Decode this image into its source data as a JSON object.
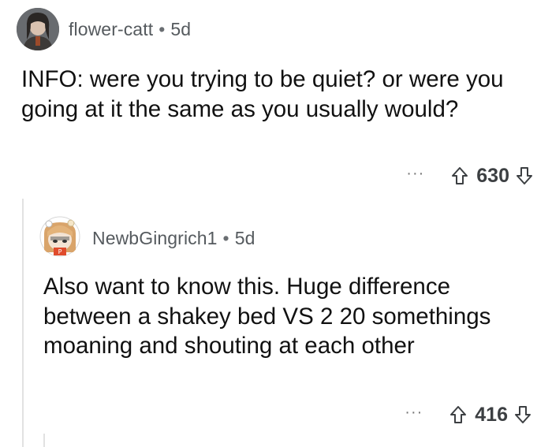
{
  "comments": [
    {
      "username": "flower-catt",
      "separator": "•",
      "age": "5d",
      "text": "INFO: were you trying to be quiet? or were you going at it the same as you usually would?",
      "more": "···",
      "score": "630",
      "avatar_icon": "user-avatar-photo"
    },
    {
      "username": "NewbGingrich1",
      "separator": "•",
      "age": "5d",
      "text": "Also want to know this. Huge difference between a shakey bed VS 2 20 somethings moaning and shouting at each other",
      "more": "···",
      "score": "416",
      "avatar_icon": "snoo-avatar"
    }
  ],
  "colors": {
    "username": "#555a5e",
    "body": "#111111",
    "score": "#3c3f42",
    "thread_line": "#e2e2e2"
  }
}
